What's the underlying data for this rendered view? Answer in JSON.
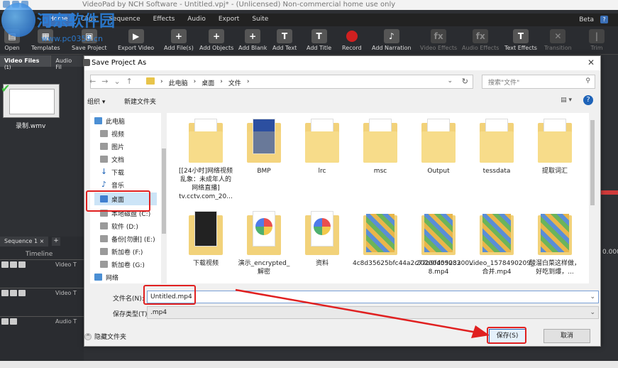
{
  "app": {
    "title": "VideoPad by NCH Software - Untitled.vpj* - (Unlicensed) Non-commercial home use only"
  },
  "menu": {
    "items": [
      "Home",
      "Clips",
      "Sequence",
      "Effects",
      "Audio",
      "Export",
      "Suite"
    ],
    "active": "Home",
    "beta": "Beta",
    "help": "?"
  },
  "toolbar": {
    "buttons": [
      {
        "label": "Open",
        "icon": "open-icon"
      },
      {
        "label": "Templates",
        "icon": "templates-icon"
      },
      {
        "label": "Save Project",
        "icon": "save-project-icon"
      },
      {
        "label": "Export Video",
        "icon": "export-video-icon"
      },
      {
        "label": "Add File(s)",
        "icon": "add-files-icon"
      },
      {
        "label": "Add Objects",
        "icon": "add-objects-icon"
      },
      {
        "label": "Add Blank",
        "icon": "add-blank-icon"
      },
      {
        "label": "Add Text",
        "icon": "text-icon"
      },
      {
        "label": "Add Title",
        "icon": "title-icon"
      },
      {
        "label": "Record",
        "icon": "record-icon"
      },
      {
        "label": "Add Narration",
        "icon": "microphone-icon"
      },
      {
        "label": "Video Effects",
        "icon": "video-effects-icon"
      },
      {
        "label": "Audio Effects",
        "icon": "audio-effects-icon"
      },
      {
        "label": "Text Effects",
        "icon": "text-effects-icon"
      },
      {
        "label": "Transition",
        "icon": "transition-icon"
      },
      {
        "label": "Trim",
        "icon": "trim-icon"
      }
    ]
  },
  "left_panel": {
    "tabs": [
      "Video Files",
      "Audio Fil"
    ],
    "tab_count": "(1)",
    "clip_name": "录制.wmv"
  },
  "sequence": {
    "tab": "Sequence 1",
    "close": "×",
    "add": "+",
    "timeline_label": "Timeline",
    "tracks": [
      {
        "name": "Video T"
      },
      {
        "name": "Video T"
      },
      {
        "name": "Audio T"
      }
    ]
  },
  "right_strip": {
    "timecode": "0.000"
  },
  "dialog": {
    "title": "Save Project As",
    "close": "✕",
    "address": {
      "crumbs": [
        "此电脑",
        "桌面",
        "文件"
      ],
      "separator": "›"
    },
    "search_placeholder": "搜索\"文件\"",
    "commands": {
      "organize": "组织 ▾",
      "new_folder": "新建文件夹",
      "view": "▤ ▾",
      "help": "?"
    },
    "nav_items": [
      {
        "label": "此电脑",
        "icon": "computer-icon"
      },
      {
        "label": "视频",
        "icon": "video-folder-icon"
      },
      {
        "label": "图片",
        "icon": "pictures-folder-icon"
      },
      {
        "label": "文档",
        "icon": "documents-folder-icon"
      },
      {
        "label": "下载",
        "icon": "download-icon"
      },
      {
        "label": "音乐",
        "icon": "music-icon"
      },
      {
        "label": "桌面",
        "icon": "desktop-icon"
      },
      {
        "label": "本地磁盘 (C:)",
        "icon": "drive-icon"
      },
      {
        "label": "软件 (D:)",
        "icon": "drive-icon"
      },
      {
        "label": "备份[勿删] (E:)",
        "icon": "drive-icon"
      },
      {
        "label": "新加卷 (F:)",
        "icon": "drive-icon"
      },
      {
        "label": "新加卷 (G:)",
        "icon": "drive-icon"
      },
      {
        "label": "网络",
        "icon": "network-icon"
      }
    ],
    "selected_nav": "桌面",
    "files_row1": [
      {
        "name": "[[24小时]网络视频乱象：未成年人的网络直播] tv.cctv.com_20...",
        "kind": "folder-doc"
      },
      {
        "name": "BMP",
        "kind": "folder-blue"
      },
      {
        "name": "lrc",
        "kind": "folder-doc"
      },
      {
        "name": "msc",
        "kind": "folder-doc"
      },
      {
        "name": "Output",
        "kind": "folder-doc"
      },
      {
        "name": "tessdata",
        "kind": "folder-doc"
      },
      {
        "name": "提取词汇",
        "kind": "folder-doc"
      }
    ],
    "files_row2": [
      {
        "name": "下载视频",
        "kind": "folder-dark"
      },
      {
        "name": "演示_encrypted_解密",
        "kind": "folder-color"
      },
      {
        "name": "资料",
        "kind": "folder-color"
      },
      {
        "name": "4c8d35625bfc44a2c77b9fd5523200...",
        "kind": "folder-pic"
      },
      {
        "name": "20200409083 8.mp4",
        "kind": "folder-pic"
      },
      {
        "name": "Video_1578490209_合并.mp4",
        "kind": "folder-pic"
      },
      {
        "name": "酸溜白菜这样做，好吃到爆，...",
        "kind": "folder-pic"
      }
    ],
    "filename_label": "文件名(N):",
    "filename_value": "Untitled.mp4",
    "filetype_label": "保存类型(T):",
    "filetype_value": ".mp4",
    "hide_folders": "隐藏文件夹",
    "save_button": "保存(S)",
    "cancel_button": "取消"
  },
  "watermark": {
    "text": "河东软件园",
    "url": "www.pc0359.cn"
  },
  "colors": {
    "accent": "#1e63b8",
    "annotation": "#e02020",
    "folder": "#f2d27a"
  }
}
